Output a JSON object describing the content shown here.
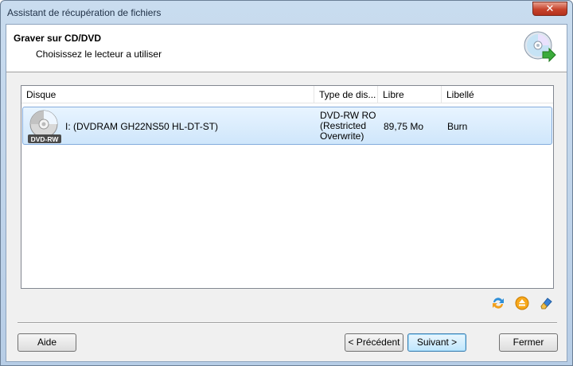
{
  "window": {
    "title": "Assistant de récupération de fichiers",
    "close_label": "✕"
  },
  "header": {
    "title": "Graver sur CD/DVD",
    "subtitle": "Choisissez le lecteur a utiliser",
    "icon": "disc-burn-icon"
  },
  "list": {
    "columns": [
      "Disque",
      "Type de dis...",
      "Libre",
      "Libellé"
    ],
    "rows": [
      {
        "icon": "dvd-rw-disc-icon",
        "icon_badge": "DVD-RW",
        "disque": "I: (DVDRAM GH22NS50 HL-DT-ST)",
        "type_line1": "DVD-RW RO",
        "type_line2": "(Restricted",
        "type_line3": "Overwrite)",
        "libre": "89,75 Mo",
        "libelle": "Burn"
      }
    ]
  },
  "tools": [
    "refresh-icon",
    "eject-icon",
    "erase-icon"
  ],
  "buttons": {
    "help": "Aide",
    "previous": "< Précédent",
    "next": "Suivant >",
    "close": "Fermer"
  },
  "colors": {
    "selection": "#cfe6fb",
    "selection_border": "#84acdd",
    "titlebar": "#c9dcef",
    "close": "#c7432c"
  }
}
